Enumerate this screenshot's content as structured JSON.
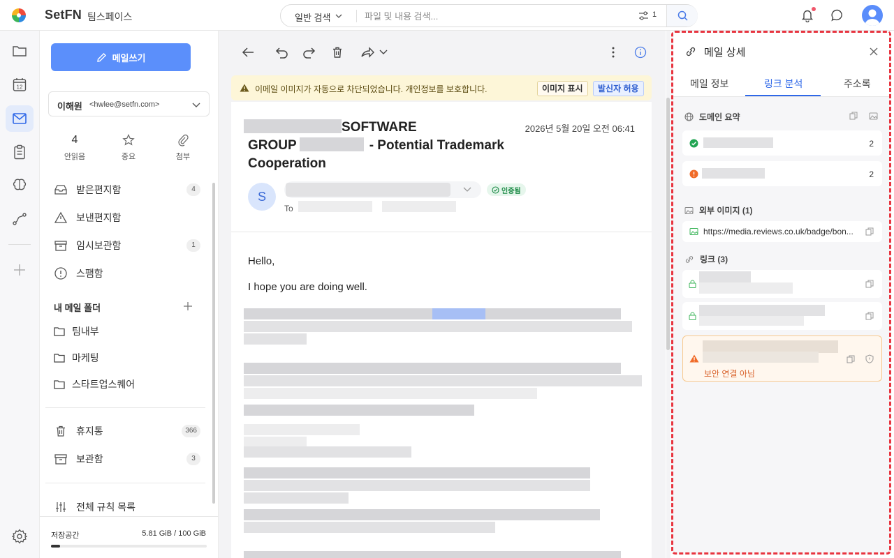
{
  "topbar": {
    "brand": "SetFN",
    "workspace": "팀스페이스",
    "search_mode": "일반 검색",
    "search_placeholder": "파일 및 내용 검색...",
    "filter_count": "1",
    "icons": [
      "logo-icon",
      "chevron-down-icon",
      "filter-icon",
      "search-icon",
      "bell-icon",
      "chat-icon",
      "user-avatar-icon"
    ]
  },
  "rail": {
    "items": [
      "folder-icon",
      "calendar-icon",
      "mail-icon",
      "clipboard-icon",
      "brain-icon",
      "flow-icon",
      "plus-icon",
      "settings-icon"
    ],
    "calendar_day": "12",
    "active": "mail"
  },
  "sidebar": {
    "compose_label": "메일쓰기",
    "account_name": "이해원",
    "account_email": "<hwlee@setfn.com>",
    "stats": [
      {
        "value": "4",
        "label": "안읽음"
      },
      {
        "icon": "star-icon",
        "label": "중요"
      },
      {
        "icon": "paperclip-icon",
        "label": "첨부"
      }
    ],
    "mailboxes": [
      {
        "label": "받은편지함",
        "count": "4"
      },
      {
        "label": "보낸편지함"
      },
      {
        "label": "임시보관함",
        "count": "1"
      },
      {
        "label": "스팸함"
      }
    ],
    "my_folders_title": "내 메일 폴더",
    "folders": [
      "팀내부",
      "마케팅",
      "스타트업스퀘어"
    ],
    "trash": {
      "label": "휴지통",
      "count": "366"
    },
    "archive": {
      "label": "보관함",
      "count": "3"
    },
    "rules_label": "전체 규칙 목록",
    "storage_label": "저장공간",
    "storage_value": "5.81 GiB / 100 GiB",
    "storage_fraction": 0.0581
  },
  "warning": {
    "text": "이메일 이미지가 자동으로 차단되었습니다. 개인정보를 보호합니다.",
    "show_images": "이미지 표시",
    "allow_sender": "발신자 허용"
  },
  "mail": {
    "subject_line1": "SOFTWARE",
    "subject_line2": "GROUP",
    "subject_line2b": "- Potential Trademark",
    "subject_line3": "Cooperation",
    "date": "2026년 5월 20일 오전 06:41",
    "sender_initial": "S",
    "verified": "인증됨",
    "to_label": "To",
    "greeting": "Hello,",
    "line2": "I hope you are doing well."
  },
  "panel": {
    "title": "메일 상세",
    "tabs": [
      "메일 정보",
      "링크 분석",
      "주소록"
    ],
    "active_tab": 1,
    "domain_summary_title": "도메인 요약",
    "domains": [
      {
        "status": "ok",
        "count": "2"
      },
      {
        "status": "warn",
        "count": "2"
      }
    ],
    "external_images_title": "외부 이미지 (1)",
    "external_image_url": "https://media.reviews.co.uk/badge/bon...",
    "links_title": "링크 (3)",
    "insecure_label": "보안 연결 아님",
    "colors": {
      "accent": "#2f68e8",
      "ok": "#22a553",
      "warn": "#f06b28",
      "highlight": "#e8343f"
    }
  }
}
